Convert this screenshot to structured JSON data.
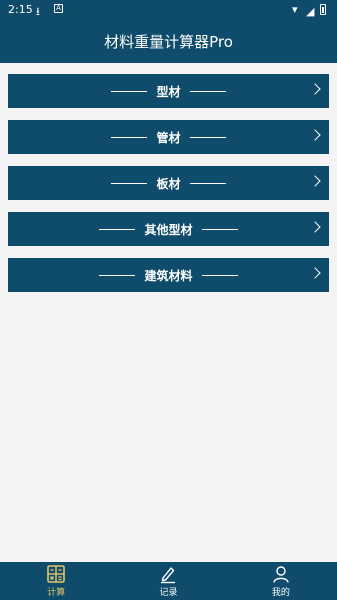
{
  "status": {
    "time": "2:15"
  },
  "app": {
    "title": "材料重量计算器Pro"
  },
  "menu": {
    "items": [
      {
        "label": "型材"
      },
      {
        "label": "管材"
      },
      {
        "label": "板材"
      },
      {
        "label": "其他型材"
      },
      {
        "label": "建筑材料"
      }
    ]
  },
  "tabs": {
    "items": [
      {
        "label": "计算",
        "icon": "calculator-icon",
        "active": true
      },
      {
        "label": "记录",
        "icon": "edit-icon",
        "active": false
      },
      {
        "label": "我的",
        "icon": "user-icon",
        "active": false
      }
    ]
  },
  "colors": {
    "primary": "#0f4b6b",
    "accent": "#e6c66a",
    "background": "#f3f3f3"
  }
}
